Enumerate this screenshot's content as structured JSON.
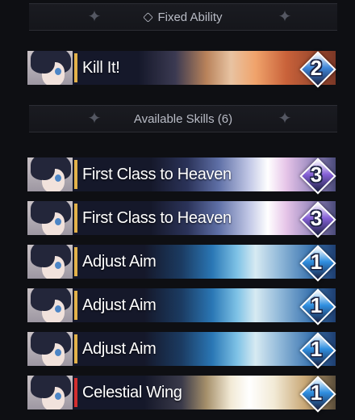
{
  "fixed_ability": {
    "header": "Fixed Ability",
    "skills": [
      {
        "name": "Kill It!",
        "cost": "2",
        "stripe_color": "#e3b24a",
        "gem_color": "#3e86d8",
        "art": "explosion"
      }
    ]
  },
  "available_skills": {
    "header": "Available Skills (6)",
    "skills": [
      {
        "name": "First Class to Heaven",
        "cost": "3",
        "stripe_color": "#e3b24a",
        "gem_color": "#8560d6",
        "art": "slash"
      },
      {
        "name": "First Class to Heaven",
        "cost": "3",
        "stripe_color": "#e3b24a",
        "gem_color": "#8560d6",
        "art": "slash"
      },
      {
        "name": "Adjust Aim",
        "cost": "1",
        "stripe_color": "#e3b24a",
        "gem_color": "#2f8fe0",
        "art": "glove"
      },
      {
        "name": "Adjust Aim",
        "cost": "1",
        "stripe_color": "#e3b24a",
        "gem_color": "#2f8fe0",
        "art": "glove"
      },
      {
        "name": "Adjust Aim",
        "cost": "1",
        "stripe_color": "#e3b24a",
        "gem_color": "#2f8fe0",
        "art": "glove"
      },
      {
        "name": "Celestial Wing",
        "cost": "1",
        "stripe_color": "#d32e2e",
        "gem_color": "#2f8fe0",
        "art": "wing"
      }
    ]
  }
}
